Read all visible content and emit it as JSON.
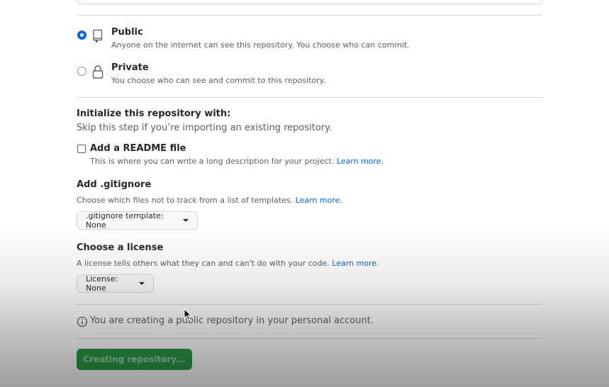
{
  "visibility": {
    "public": {
      "title": "Public",
      "description": "Anyone on the internet can see this repository. You choose who can commit.",
      "selected": true
    },
    "private": {
      "title": "Private",
      "description": "You choose who can see and commit to this repository.",
      "selected": false
    }
  },
  "init": {
    "title": "Initialize this repository with:",
    "subtitle": "Skip this step if you’re importing an existing repository.",
    "readme": {
      "label": "Add a README file",
      "description": "This is where you can write a long description for your project.",
      "learn_more": "Learn more.",
      "checked": false
    }
  },
  "gitignore": {
    "title": "Add .gitignore",
    "description": "Choose which files not to track from a list of templates.",
    "learn_more": "Learn more.",
    "button_label": ".gitignore template: None"
  },
  "license": {
    "title": "Choose a license",
    "description": "A license tells others what they can and can't do with your code.",
    "learn_more": "Learn more.",
    "button_label": "License: None"
  },
  "notice": {
    "text": "You are creating a public repository in your personal account."
  },
  "submit": {
    "label": "Creating repository..."
  },
  "colors": {
    "accent": "#0969da",
    "primary_button": "#2c974b",
    "border": "#d0d7de"
  }
}
